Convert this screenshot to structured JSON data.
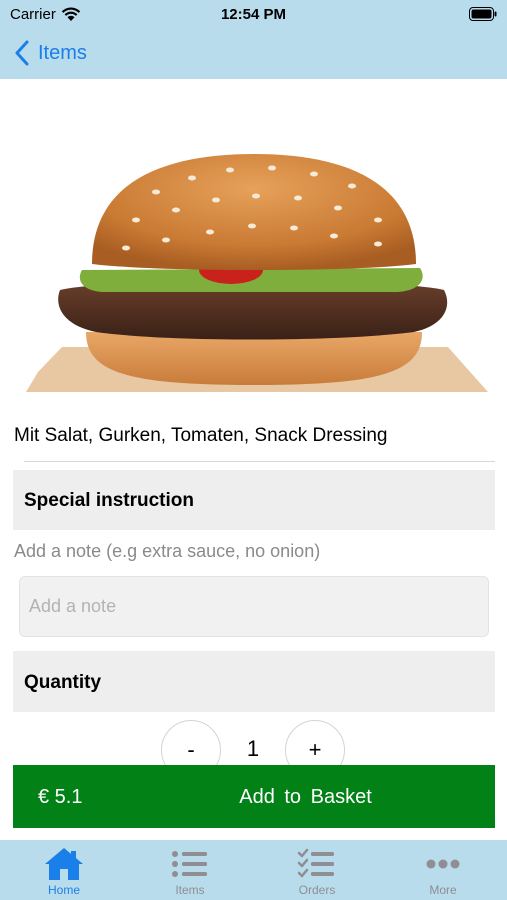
{
  "status_bar": {
    "carrier": "Carrier",
    "time": "12:54 PM"
  },
  "nav": {
    "back_label": "Items"
  },
  "product": {
    "image_icon": "burger-image",
    "description": "Mit Salat, Gurken, Tomaten, Snack Dressing"
  },
  "special_instruction": {
    "header": "Special instruction",
    "hint": "Add a note (e.g extra sauce, no onion)",
    "placeholder": "Add a note",
    "value": ""
  },
  "quantity": {
    "header": "Quantity",
    "minus_label": "-",
    "plus_label": "+",
    "value": "1"
  },
  "basket": {
    "price": "€ 5.1",
    "label": "Add to Basket",
    "color": "#018116"
  },
  "tabs": [
    {
      "label": "Home",
      "icon": "house-icon",
      "active": true
    },
    {
      "label": "Items",
      "icon": "list-icon",
      "active": false
    },
    {
      "label": "Orders",
      "icon": "checklist-icon",
      "active": false
    },
    {
      "label": "More",
      "icon": "more-icon",
      "active": false
    }
  ],
  "colors": {
    "accent": "#1a7fe8",
    "bar_background": "#b8dcec",
    "inactive": "#8e8e93"
  }
}
